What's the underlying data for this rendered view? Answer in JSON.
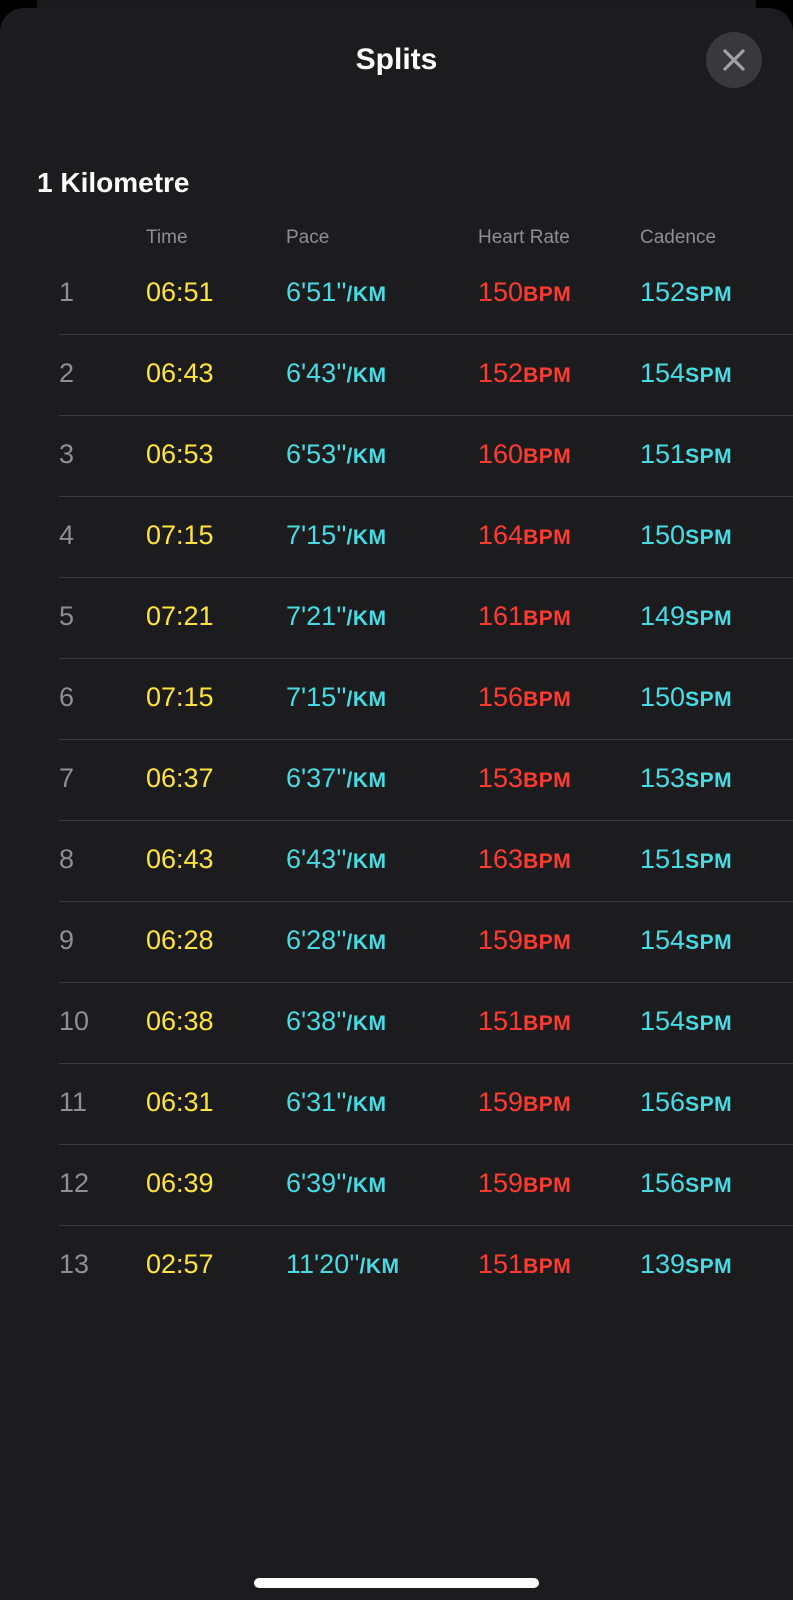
{
  "header": {
    "title": "Splits",
    "close_icon": "close-icon"
  },
  "section": {
    "title": "1 Kilometre"
  },
  "columns": {
    "time": "Time",
    "pace": "Pace",
    "heart_rate": "Heart Rate",
    "cadence": "Cadence"
  },
  "units": {
    "pace": "/KM",
    "heart_rate": "BPM",
    "cadence": "SPM"
  },
  "colors": {
    "time": "#ffe43a",
    "pace": "#47dbe3",
    "heart_rate": "#ff3b30",
    "cadence": "#47dbe3",
    "background": "#1c1c1e"
  },
  "splits": [
    {
      "index": "1",
      "time": "06:51",
      "pace": "6'51''",
      "heart_rate": "150",
      "cadence": "152"
    },
    {
      "index": "2",
      "time": "06:43",
      "pace": "6'43''",
      "heart_rate": "152",
      "cadence": "154"
    },
    {
      "index": "3",
      "time": "06:53",
      "pace": "6'53''",
      "heart_rate": "160",
      "cadence": "151"
    },
    {
      "index": "4",
      "time": "07:15",
      "pace": "7'15''",
      "heart_rate": "164",
      "cadence": "150"
    },
    {
      "index": "5",
      "time": "07:21",
      "pace": "7'21''",
      "heart_rate": "161",
      "cadence": "149"
    },
    {
      "index": "6",
      "time": "07:15",
      "pace": "7'15''",
      "heart_rate": "156",
      "cadence": "150"
    },
    {
      "index": "7",
      "time": "06:37",
      "pace": "6'37''",
      "heart_rate": "153",
      "cadence": "153"
    },
    {
      "index": "8",
      "time": "06:43",
      "pace": "6'43''",
      "heart_rate": "163",
      "cadence": "151"
    },
    {
      "index": "9",
      "time": "06:28",
      "pace": "6'28''",
      "heart_rate": "159",
      "cadence": "154"
    },
    {
      "index": "10",
      "time": "06:38",
      "pace": "6'38''",
      "heart_rate": "151",
      "cadence": "154"
    },
    {
      "index": "11",
      "time": "06:31",
      "pace": "6'31''",
      "heart_rate": "159",
      "cadence": "156"
    },
    {
      "index": "12",
      "time": "06:39",
      "pace": "6'39''",
      "heart_rate": "159",
      "cadence": "156"
    },
    {
      "index": "13",
      "time": "02:57",
      "pace": "11'20''",
      "heart_rate": "151",
      "cadence": "139"
    }
  ]
}
